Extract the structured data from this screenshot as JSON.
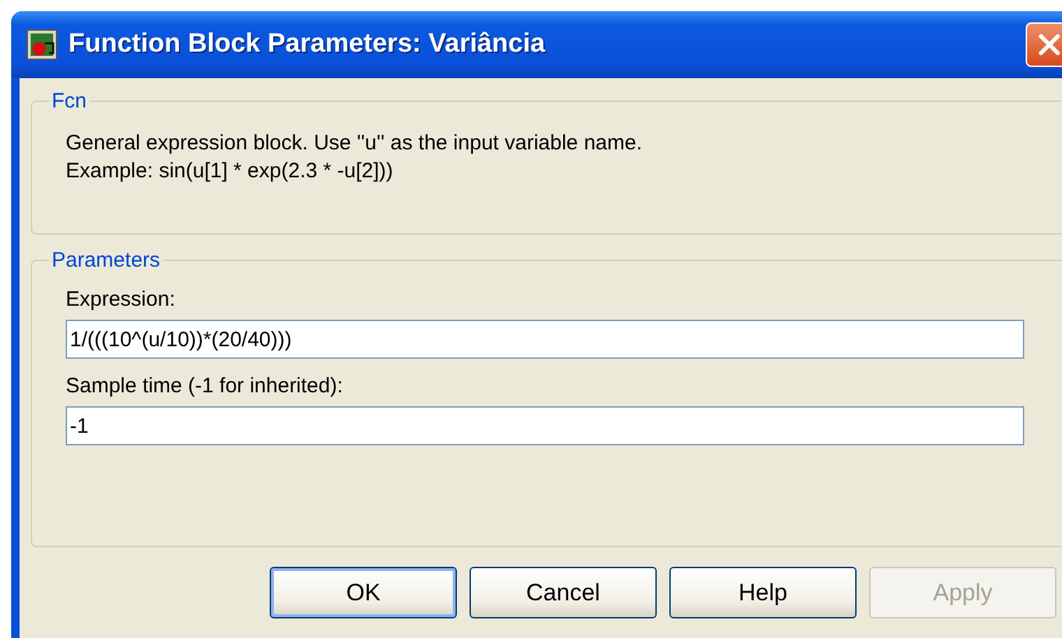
{
  "window": {
    "title": "Function Block Parameters: Variância"
  },
  "description_group": {
    "title": "Fcn",
    "lines": [
      "General expression block. Use ''u'' as the input variable name.",
      "Example: sin(u[1] * exp(2.3 * -u[2]))"
    ]
  },
  "parameters_group": {
    "title": "Parameters",
    "fields": [
      {
        "label": "Expression:",
        "value": "1/(((10^(u/10))*(20/40)))"
      },
      {
        "label": "Sample time (-1 for inherited):",
        "value": "-1"
      }
    ]
  },
  "buttons": [
    {
      "label": "OK",
      "default": true,
      "disabled": false
    },
    {
      "label": "Cancel",
      "default": false,
      "disabled": false
    },
    {
      "label": "Help",
      "default": false,
      "disabled": false
    },
    {
      "label": "Apply",
      "default": false,
      "disabled": true
    }
  ]
}
